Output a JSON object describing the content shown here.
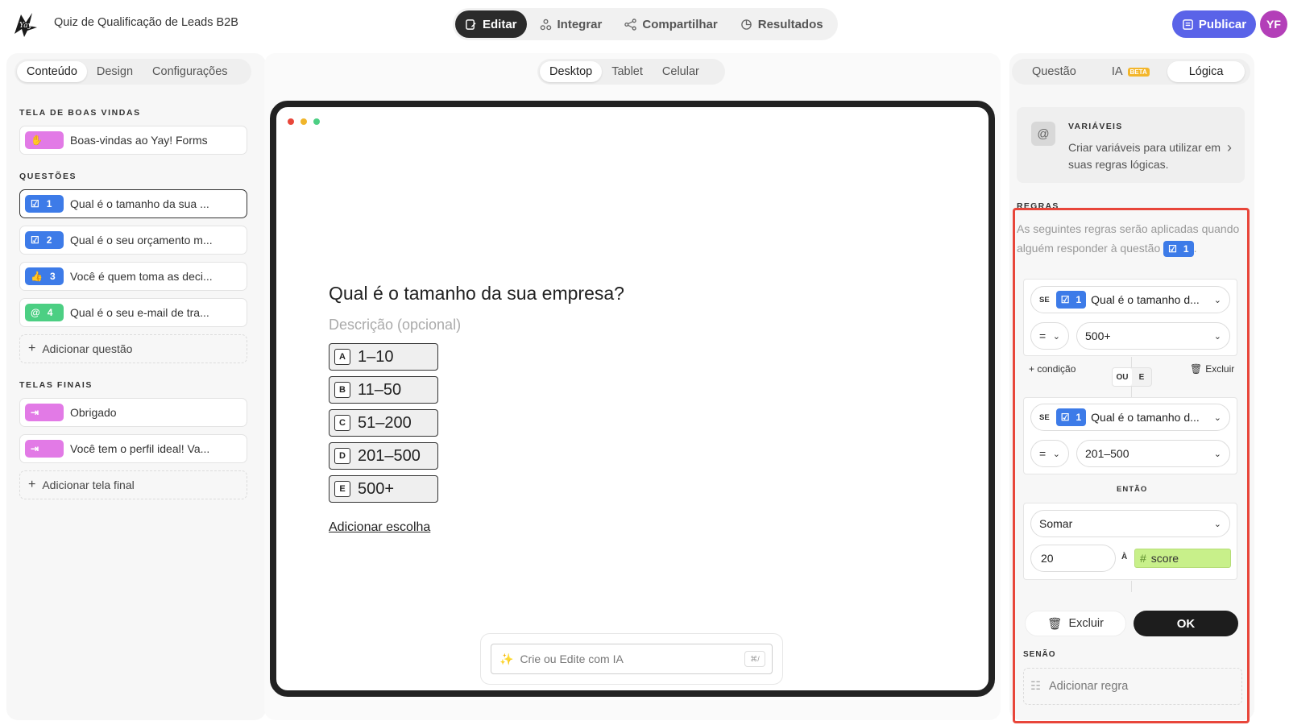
{
  "app": {
    "title": "Quiz de Qualificação de Leads B2B",
    "avatar_initials": "YF"
  },
  "top_nav": {
    "items": [
      {
        "label": "Editar",
        "icon": "edit-icon",
        "active": true
      },
      {
        "label": "Integrar",
        "icon": "integrate-icon",
        "active": false
      },
      {
        "label": "Compartilhar",
        "icon": "share-icon",
        "active": false
      },
      {
        "label": "Resultados",
        "icon": "results-icon",
        "active": false
      }
    ],
    "publish_label": "Publicar"
  },
  "left": {
    "tabs": [
      "Conteúdo",
      "Design",
      "Configurações"
    ],
    "welcome_label": "TELA DE BOAS VINDAS",
    "welcome_item": "Boas-vindas ao Yay! Forms",
    "questions_label": "QUESTÕES",
    "questions": [
      {
        "num": "1",
        "text": "Qual é o tamanho da sua ...",
        "icon": "checkbox-icon"
      },
      {
        "num": "2",
        "text": "Qual é o seu orçamento m...",
        "icon": "checkbox-icon"
      },
      {
        "num": "3",
        "text": "Você é quem toma as deci...",
        "icon": "thumbs-up-icon"
      },
      {
        "num": "4",
        "text": "Qual é o seu e-mail de tra...",
        "icon": "at-icon"
      }
    ],
    "add_question": "Adicionar questão",
    "endings_label": "TELAS FINAIS",
    "endings": [
      "Obrigado",
      "Você tem o perfil ideal! Va..."
    ],
    "add_ending": "Adicionar tela final"
  },
  "center": {
    "device_tabs": [
      "Desktop",
      "Tablet",
      "Celular"
    ],
    "question_title": "Qual é o tamanho da sua empresa?",
    "description_placeholder": "Descrição (opcional)",
    "choices": [
      {
        "key": "A",
        "label": "1–10"
      },
      {
        "key": "B",
        "label": "11–50"
      },
      {
        "key": "C",
        "label": "51–200"
      },
      {
        "key": "D",
        "label": "201–500"
      },
      {
        "key": "E",
        "label": "500+"
      }
    ],
    "add_choice": "Adicionar escolha",
    "ai_placeholder": "Crie ou Edite com IA",
    "ai_shortcut": "⌘/"
  },
  "right": {
    "tabs": [
      "Questão",
      "IA",
      "Lógica"
    ],
    "ia_badge": "BETA",
    "variables_title": "VARIÁVEIS",
    "variables_text": "Criar variáveis para utilizar em suas regras lógicas.",
    "rules_heading": "REGRAS",
    "rules_intro": "As seguintes regras serão aplicadas quando alguém responder à questão",
    "rules_question_num": "1",
    "se_label": "SE",
    "condition_1": {
      "question": "Qual é o tamanho d...",
      "num": "1",
      "operator": "=",
      "value": "500+"
    },
    "add_condition": "+ condição",
    "delete_label": "Excluir",
    "ou_label": "OU",
    "e_label": "E",
    "condition_2": {
      "question": "Qual é o tamanho d...",
      "num": "1",
      "operator": "=",
      "value": "201–500"
    },
    "then_label": "ENTÃO",
    "action": "Somar",
    "action_amount": "20",
    "to_label": "À",
    "variable_name": "score",
    "excluir_button": "Excluir",
    "ok_button": "OK",
    "else_label": "SENÃO",
    "add_rule": "Adicionar regra"
  },
  "colors": {
    "accent": "#5a63e8",
    "question_blue": "#3d7be8",
    "highlight": "#e8463a",
    "score_green": "#c8f08a"
  }
}
